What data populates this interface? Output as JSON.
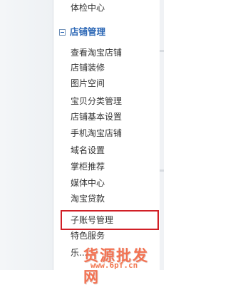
{
  "sidebar": {
    "top_item": "体检中心",
    "section_title": "店铺管理",
    "items": [
      "查看淘宝店铺",
      "店铺装修",
      "图片空间",
      "宝贝分类管理",
      "店铺基本设置",
      "手机淘宝店铺",
      "域名设置",
      "掌柜推荐",
      "媒体中心",
      "淘宝贷款",
      "子账号管理",
      "特色服务",
      "乐..."
    ],
    "highlighted_item": "子账号管理"
  },
  "watermark": {
    "text": "货源批发网",
    "url": "www.6pf.cn"
  },
  "colors": {
    "section_title": "#2d68b6",
    "highlight_border": "#d11f26",
    "watermark": "#f05a35"
  },
  "icons": {
    "section_toggle": "collapse-minus-icon"
  }
}
